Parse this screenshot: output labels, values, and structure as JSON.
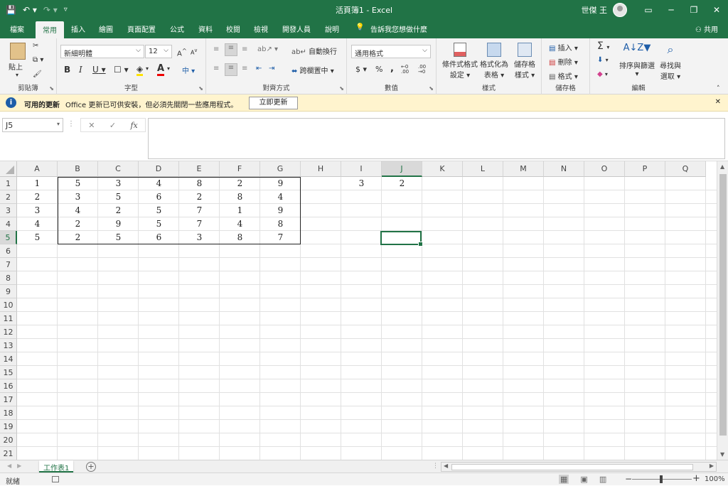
{
  "window": {
    "title": "活頁簿1  -  Excel",
    "user": "世傑 王"
  },
  "ribbon_tabs": [
    "檔案",
    "常用",
    "插入",
    "繪圖",
    "頁面配置",
    "公式",
    "資料",
    "校閱",
    "檢視",
    "開發人員",
    "說明"
  ],
  "tell_me": "告訴我您想做什麼",
  "share": "共用",
  "clipboard": {
    "paste": "貼上",
    "label": "剪貼簿"
  },
  "font": {
    "name": "新細明體",
    "size": "12",
    "grow": "A",
    "shrink": "A",
    "bold": "B",
    "italic": "I",
    "underline": "U",
    "label": "字型",
    "phonetic": "中"
  },
  "alignment": {
    "wrap": "自動換行",
    "merge": "跨欄置中",
    "label": "對齊方式"
  },
  "number": {
    "format": "通用格式",
    "currency": "$",
    "percent": "%",
    "comma": ",",
    "inc": ".00",
    "dec": ".00",
    "label": "數值"
  },
  "styles": {
    "conditional": [
      "條件式格式",
      "設定"
    ],
    "table": [
      "格式化為",
      "表格"
    ],
    "cell": [
      "儲存格",
      "樣式"
    ],
    "label": "樣式"
  },
  "cells": {
    "insert": "插入",
    "delete": "刪除",
    "format": "格式",
    "label": "儲存格"
  },
  "editing": {
    "sigma": "Σ",
    "sort": [
      "排序與篩選"
    ],
    "find": [
      "尋找與",
      "選取"
    ],
    "label": "編輯"
  },
  "message_bar": {
    "title": "可用的更新",
    "text": "Office 更新已可供安裝，但必須先關閉一些應用程式。",
    "button": "立即更新"
  },
  "formula_bar": {
    "name_box": "J5",
    "fx": "fx",
    "cancel": "✕",
    "enter": "✓",
    "value": ""
  },
  "columns": [
    "A",
    "B",
    "C",
    "D",
    "E",
    "F",
    "G",
    "H",
    "I",
    "J",
    "K",
    "L",
    "M",
    "N",
    "O",
    "P",
    "Q"
  ],
  "selected_col": "J",
  "selected_row": 5,
  "rows": [
    "1",
    "2",
    "3",
    "4",
    "5",
    "6",
    "7",
    "8",
    "9",
    "10",
    "11",
    "12",
    "13",
    "14",
    "15",
    "16",
    "17",
    "18",
    "19",
    "20",
    "21"
  ],
  "cells_data": [
    [
      "1",
      "5",
      "3",
      "4",
      "8",
      "2",
      "9",
      "",
      "3",
      "2"
    ],
    [
      "2",
      "3",
      "5",
      "6",
      "2",
      "8",
      "4",
      "",
      "",
      ""
    ],
    [
      "3",
      "4",
      "2",
      "5",
      "7",
      "1",
      "9",
      "",
      "",
      ""
    ],
    [
      "4",
      "2",
      "9",
      "5",
      "7",
      "4",
      "8",
      "",
      "",
      ""
    ],
    [
      "5",
      "2",
      "5",
      "6",
      "3",
      "8",
      "7",
      "",
      "",
      ""
    ]
  ],
  "sheet_tab": "工作表1",
  "status": {
    "ready": "就緒",
    "zoom": "100%",
    "zoom_level_percent": 100
  }
}
